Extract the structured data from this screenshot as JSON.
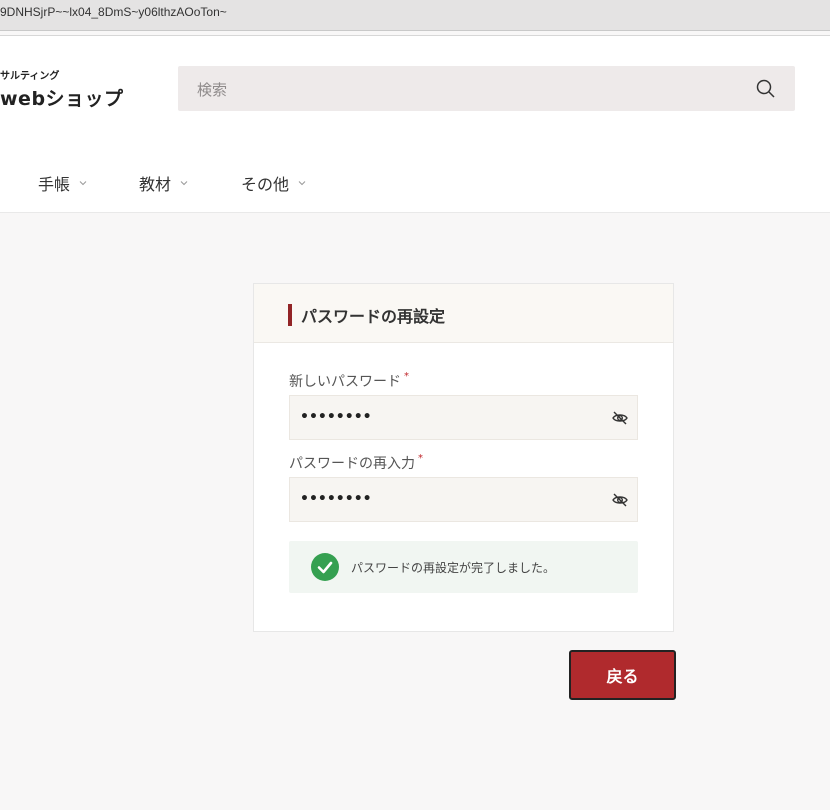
{
  "browser": {
    "url_fragment": "9DNHSjrP~~lx04_8DmS~y06lthzAOoTon~"
  },
  "header": {
    "logo_small": "サルティング",
    "logo_big": "webショップ",
    "search_placeholder": "検索"
  },
  "nav": {
    "items": [
      {
        "label": "手帳"
      },
      {
        "label": "教材"
      },
      {
        "label": "その他"
      }
    ]
  },
  "card": {
    "title": "パスワードの再設定",
    "fields": [
      {
        "label": "新しいパスワード",
        "required_mark": "*",
        "value_masked": "••••••••"
      },
      {
        "label": "パスワードの再入力",
        "required_mark": "*",
        "value_masked": "••••••••"
      }
    ],
    "success_message": "パスワードの再設定が完了しました。"
  },
  "actions": {
    "back_label": "戻る"
  },
  "colors": {
    "accent": "#922426",
    "button": "#b02a2d",
    "success": "#35a051"
  },
  "icons": [
    "search-icon",
    "chevron-down-icon",
    "eye-off-icon",
    "check-circle-icon"
  ]
}
